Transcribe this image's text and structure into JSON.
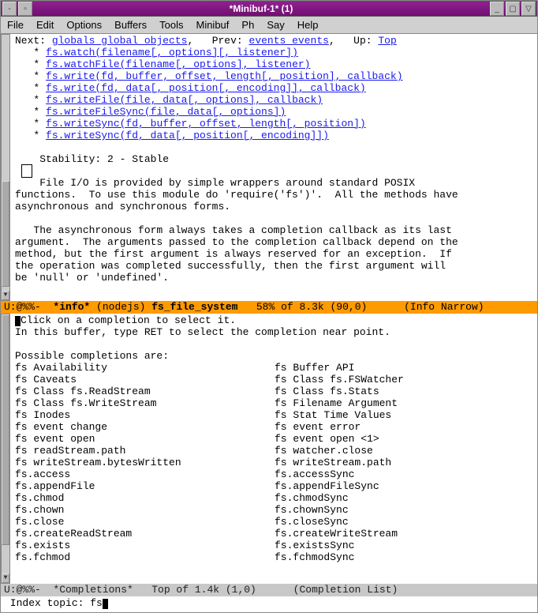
{
  "titlebar": {
    "title": "*Minibuf-1* (1)"
  },
  "menus": [
    "File",
    "Edit",
    "Options",
    "Buffers",
    "Tools",
    "Minibuf",
    "Ph",
    "Say",
    "Help"
  ],
  "nav": {
    "nextLabel": "Next:",
    "nextLink": "globals_global_objects",
    "prevLabel": "Prev:",
    "prevLink": "events_events",
    "upLabel": "Up:",
    "upLink": "Top"
  },
  "apiLinks": [
    "fs.watch(filename[, options][, listener])",
    "fs.watchFile(filename[, options], listener)",
    "fs.write(fd, buffer, offset, length[, position], callback)",
    "fs.write(fd, data[, position[, encoding]], callback)",
    "fs.writeFile(file, data[, options], callback)",
    "fs.writeFileSync(file, data[, options])",
    "fs.writeSync(fd, buffer, offset, length[, position])",
    "fs.writeSync(fd, data[, position[, encoding]])"
  ],
  "stability": "    Stability: 2 - Stable",
  "body1": "    File I/O is provided by simple wrappers around standard POSIX\nfunctions.  To use this module do 'require('fs')'.  All the methods have\nasynchronous and synchronous forms.",
  "body2": "   The asynchronous form always takes a completion callback as its last\nargument.  The arguments passed to the completion callback depend on the\nmethod, but the first argument is always reserved for an exception.  If\nthe operation was completed successfully, then the first argument will\nbe 'null' or 'undefined'.",
  "modeline1": {
    "left": "U:@%%-  ",
    "buf": "*info*",
    "mode": " (nodejs) ",
    "topic": "fs_file_system",
    "right": "   58% of 8.3k (90,0)      (Info Narrow)"
  },
  "compHeader": {
    "l1": "Click on a completion to select it.",
    "l2": "In this buffer, type RET to select the completion near point.",
    "l3": "Possible completions are:"
  },
  "completions": [
    "fs Availability",
    "fs Buffer API",
    "fs Caveats",
    "fs Class fs.FSWatcher",
    "fs Class fs.ReadStream",
    "fs Class fs.Stats",
    "fs Class fs.WriteStream",
    "fs Filename Argument",
    "fs Inodes",
    "fs Stat Time Values",
    "fs event change",
    "fs event error",
    "fs event open",
    "fs event open <1>",
    "fs readStream.path",
    "fs watcher.close",
    "fs writeStream.bytesWritten",
    "fs writeStream.path",
    "fs.access",
    "fs.accessSync",
    "fs.appendFile",
    "fs.appendFileSync",
    "fs.chmod",
    "fs.chmodSync",
    "fs.chown",
    "fs.chownSync",
    "fs.close",
    "fs.closeSync",
    "fs.createReadStream",
    "fs.createWriteStream",
    "fs.exists",
    "fs.existsSync",
    "fs.fchmod",
    "fs.fchmodSync"
  ],
  "modeline2": {
    "text": "U:@%%-  *Completions*   Top of 1.4k (1,0)      (Completion List)"
  },
  "minibuf": {
    "prompt": " Index topic: ",
    "input": "fs"
  }
}
